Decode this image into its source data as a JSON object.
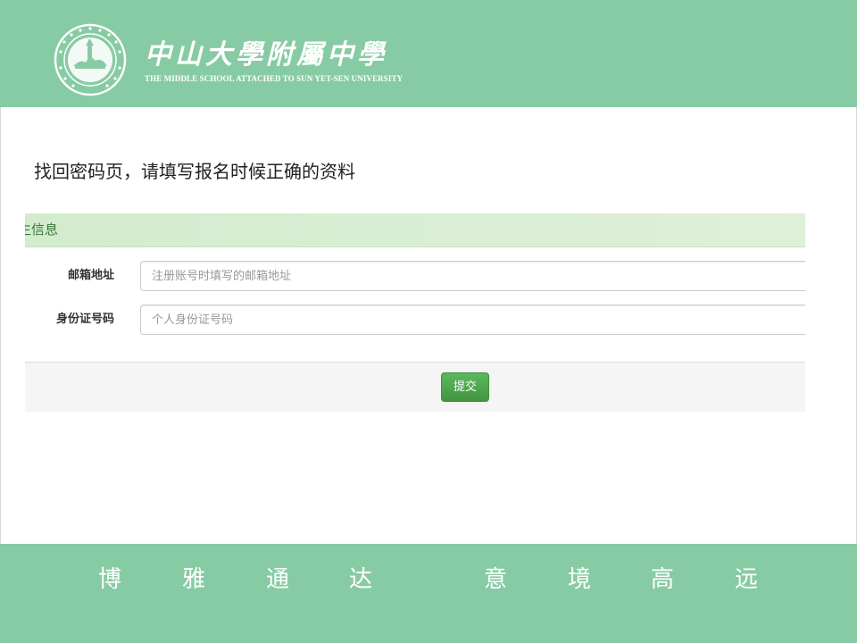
{
  "header": {
    "school_name_cn": "中山大學附屬中學",
    "school_name_en": "THE MIDDLE SCHOOL ATTACHED TO  SUN YET-SEN UNIVERSITY",
    "emblem_year": "1924",
    "bg_color": "#87cba4"
  },
  "main": {
    "heading": "找回密码页，请填写报名时候正确的资料",
    "panel_title": "生信息",
    "fields": [
      {
        "label": "邮箱地址",
        "value": "",
        "placeholder": "注册账号时填写的邮箱地址"
      },
      {
        "label": "身份证号码",
        "value": "",
        "placeholder": "个人身份证号码"
      }
    ],
    "submit_label": "提交",
    "submit_color": "#5cb85c"
  },
  "footer": {
    "motto": [
      "博",
      "雅",
      "通",
      "达",
      "意",
      "境",
      "高",
      "远"
    ]
  }
}
